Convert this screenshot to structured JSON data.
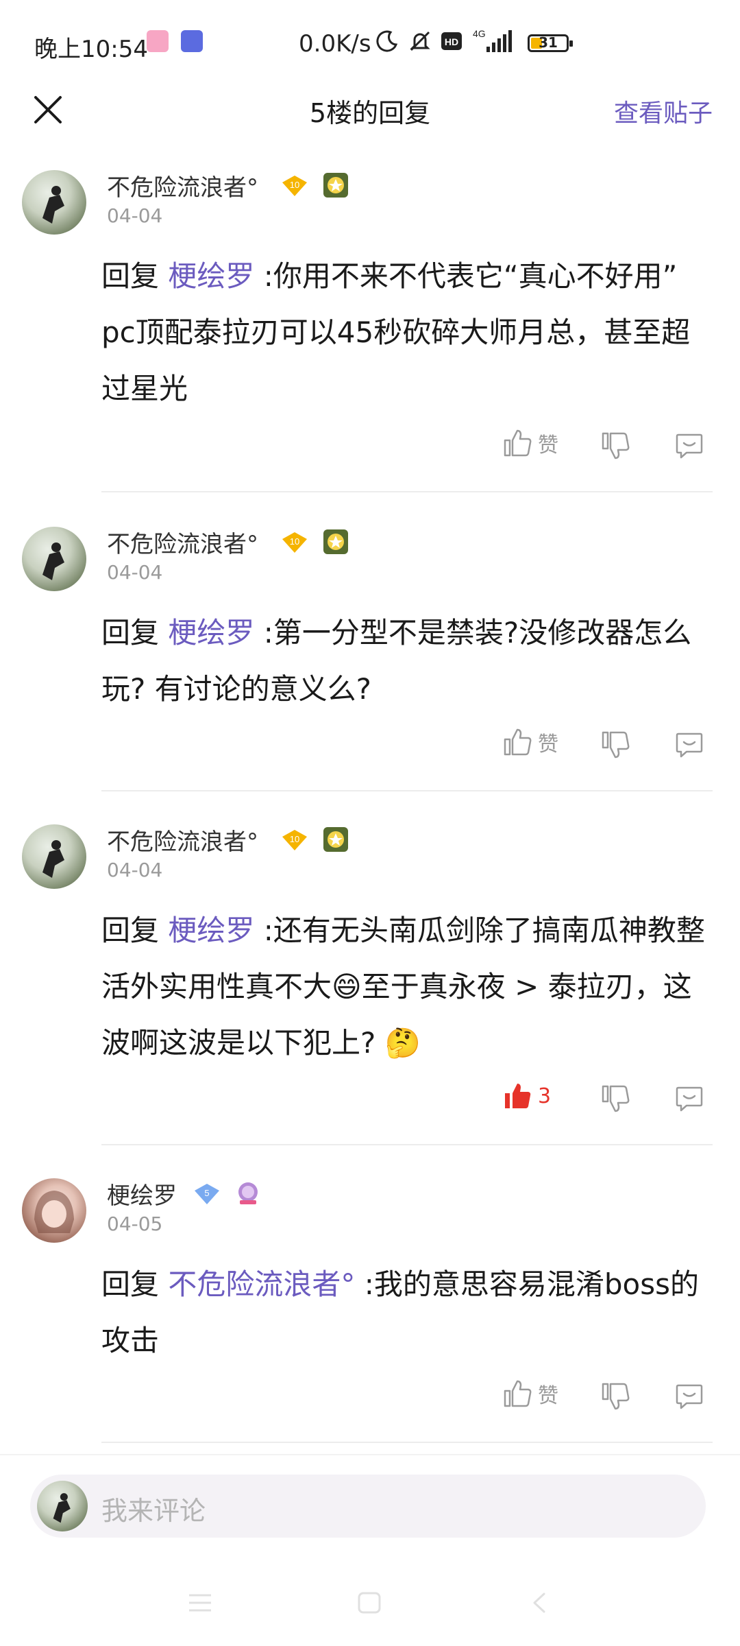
{
  "status": {
    "time": "晚上10:54",
    "net_speed": "0.0K/s",
    "network": "4G",
    "battery": "31",
    "battery_level": 0.31
  },
  "header": {
    "title": "5楼的回复",
    "view_post": "查看贴子"
  },
  "replies": [
    {
      "username": "不危险流浪者°",
      "level": "10",
      "date": "04-04",
      "prefix": "回复",
      "mention": "梗绘罗",
      "text": ":你用不来不代表它“真心不好用” pc顶配泰拉刃可以45秒砍碎大师月总，甚至超过星光",
      "like_label": "赞"
    },
    {
      "username": "不危险流浪者°",
      "level": "10",
      "date": "04-04",
      "prefix": "回复",
      "mention": "梗绘罗",
      "text": ":第一分型不是禁装?没修改器怎么玩? 有讨论的意义么?",
      "like_label": "赞"
    },
    {
      "username": "不危险流浪者°",
      "level": "10",
      "date": "04-04",
      "prefix": "回复",
      "mention": "梗绘罗",
      "text": ":还有无头南瓜剑除了搞南瓜神教整活外实用性真不大😄至于真永夜 > 泰拉刃，这波啊这波是以下犯上? 🤔",
      "like_count": "3"
    },
    {
      "username": "梗绘罗",
      "level": "5",
      "date": "04-05",
      "prefix": "回复",
      "mention": "不危险流浪者°",
      "text": ":我的意思容易混淆boss的攻击",
      "like_label": "赞"
    }
  ],
  "comment_bar": {
    "placeholder": "我来评论"
  },
  "colors": {
    "accent": "#6b5bbf",
    "like_active": "#e6332a",
    "gold_badge": "#f5b400",
    "blue_badge": "#7aaaf0"
  }
}
